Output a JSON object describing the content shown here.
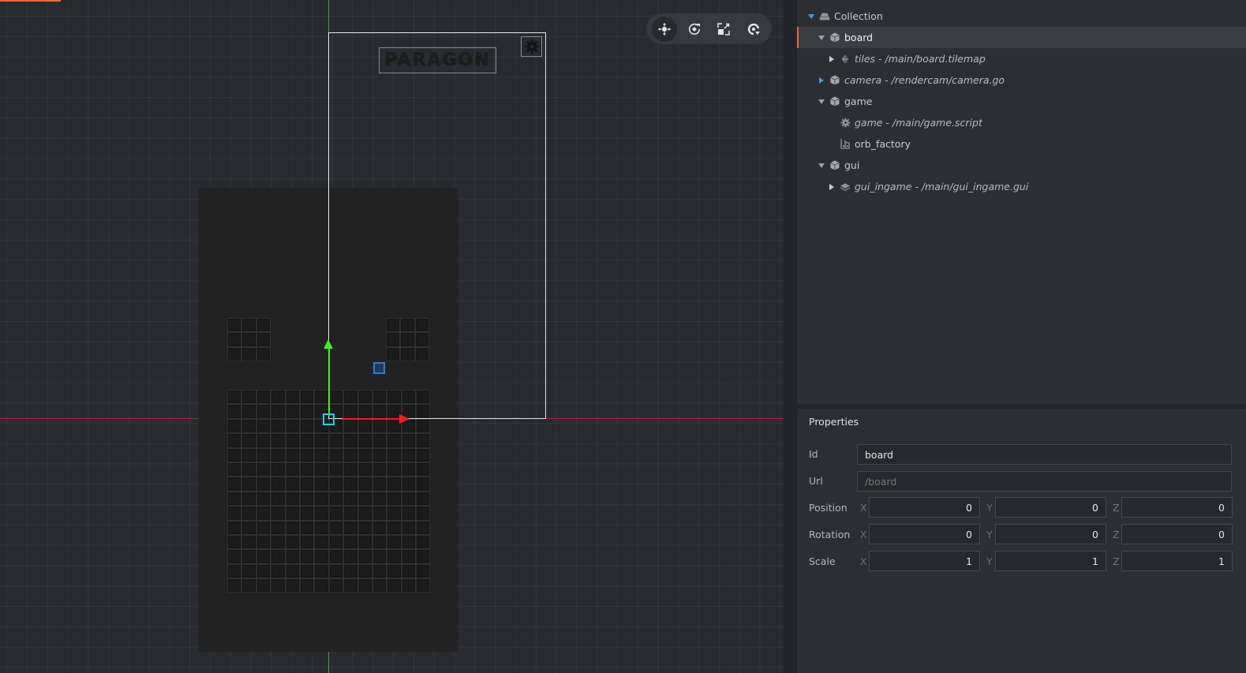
{
  "viewport": {
    "logo_text": "PARAGON",
    "colors": {
      "accent": "#f36b31",
      "x_axis": "#ff1a1a",
      "y_axis": "#3ef01a",
      "selection": "#25d0dc",
      "pivot": "#2a7fd8"
    },
    "toolbar": [
      {
        "name": "move-tool",
        "icon": "move-icon",
        "active": true
      },
      {
        "name": "rotate-tool",
        "icon": "rotate-icon",
        "active": false
      },
      {
        "name": "scale-tool",
        "icon": "scale-icon",
        "active": false
      },
      {
        "name": "camera-tool",
        "icon": "camera-reset-icon",
        "active": false
      }
    ],
    "tile_grids": [
      {
        "name": "top-left-block",
        "rows": 3,
        "cols": 3
      },
      {
        "name": "top-right-block",
        "rows": 3,
        "cols": 3
      },
      {
        "name": "main-board",
        "rows": 14,
        "cols": 14
      }
    ]
  },
  "outline": {
    "items": [
      {
        "label": "Collection",
        "icon": "collection-icon",
        "depth": 0,
        "expander": "expanded-blue",
        "italic": false,
        "selected": false
      },
      {
        "label": "board",
        "icon": "game-object-icon",
        "depth": 1,
        "expander": "expanded",
        "italic": false,
        "selected": true
      },
      {
        "label": "tiles - /main/board.tilemap",
        "icon": "tilemap-icon",
        "depth": 2,
        "expander": "collapsed",
        "italic": true,
        "selected": false
      },
      {
        "label": "camera - /rendercam/camera.go",
        "icon": "game-object-icon",
        "depth": 1,
        "expander": "collapsed-blue",
        "italic": true,
        "selected": false
      },
      {
        "label": "game",
        "icon": "game-object-icon",
        "depth": 1,
        "expander": "expanded",
        "italic": false,
        "selected": false
      },
      {
        "label": "game - /main/game.script",
        "icon": "script-gear-icon",
        "depth": 2,
        "expander": "none",
        "italic": true,
        "selected": false
      },
      {
        "label": "orb_factory",
        "icon": "factory-icon",
        "depth": 2,
        "expander": "none",
        "italic": false,
        "selected": false
      },
      {
        "label": "gui",
        "icon": "game-object-icon",
        "depth": 1,
        "expander": "expanded",
        "italic": false,
        "selected": false
      },
      {
        "label": "gui_ingame - /main/gui_ingame.gui",
        "icon": "gui-layers-icon",
        "depth": 2,
        "expander": "collapsed",
        "italic": true,
        "selected": false
      }
    ]
  },
  "properties": {
    "title": "Properties",
    "id": {
      "label": "Id",
      "value": "board"
    },
    "url": {
      "label": "Url",
      "placeholder": "/board"
    },
    "axis_labels": {
      "x": "X",
      "y": "Y",
      "z": "Z"
    },
    "position": {
      "label": "Position",
      "x": "0",
      "y": "0",
      "z": "0"
    },
    "rotation": {
      "label": "Rotation",
      "x": "0",
      "y": "0",
      "z": "0"
    },
    "scale": {
      "label": "Scale",
      "x": "1",
      "y": "1",
      "z": "1"
    }
  }
}
